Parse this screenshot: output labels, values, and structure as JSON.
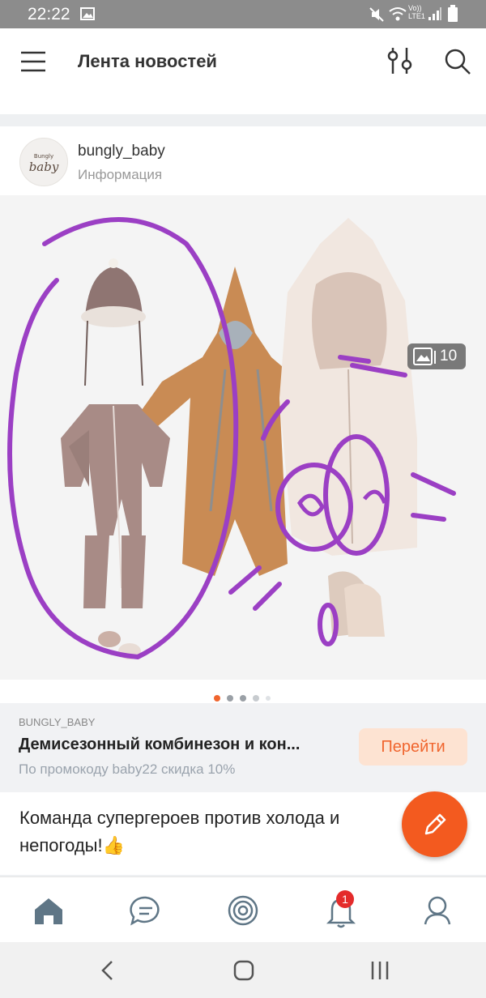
{
  "status_bar": {
    "time": "22:22",
    "icons": [
      "image-icon",
      "mute-icon",
      "wifi-icon",
      "volte-icon",
      "signal-icon",
      "battery-icon"
    ],
    "volte_text": "Vo)) LTE1"
  },
  "app_bar": {
    "title": "Лента новостей",
    "icons": [
      "menu-icon",
      "filter-icon",
      "search-icon"
    ]
  },
  "post": {
    "author": "bungly_baby",
    "subtitle": "Информация",
    "avatar_logo": "Bungly baby",
    "photo_count": "10",
    "carousel_dots": 5,
    "carousel_active": 0,
    "ad": {
      "brand": "BUNGLY_BABY",
      "title": "Демисезонный комбинезон и кон...",
      "promo": "По промокоду baby22 скидка 10%",
      "button": "Перейти"
    },
    "text": "Команда супергероев против холода и непогоды!👍"
  },
  "bottom_nav": {
    "items": [
      "home-icon",
      "messages-icon",
      "discover-icon",
      "notifications-icon",
      "profile-icon"
    ],
    "notification_badge": "1"
  },
  "system_nav": [
    "back-icon",
    "home-circle-icon",
    "recents-icon"
  ],
  "colors": {
    "accent": "#f35a1f",
    "annotation": "#9b3fc4",
    "button_bg": "#fde3d2"
  }
}
